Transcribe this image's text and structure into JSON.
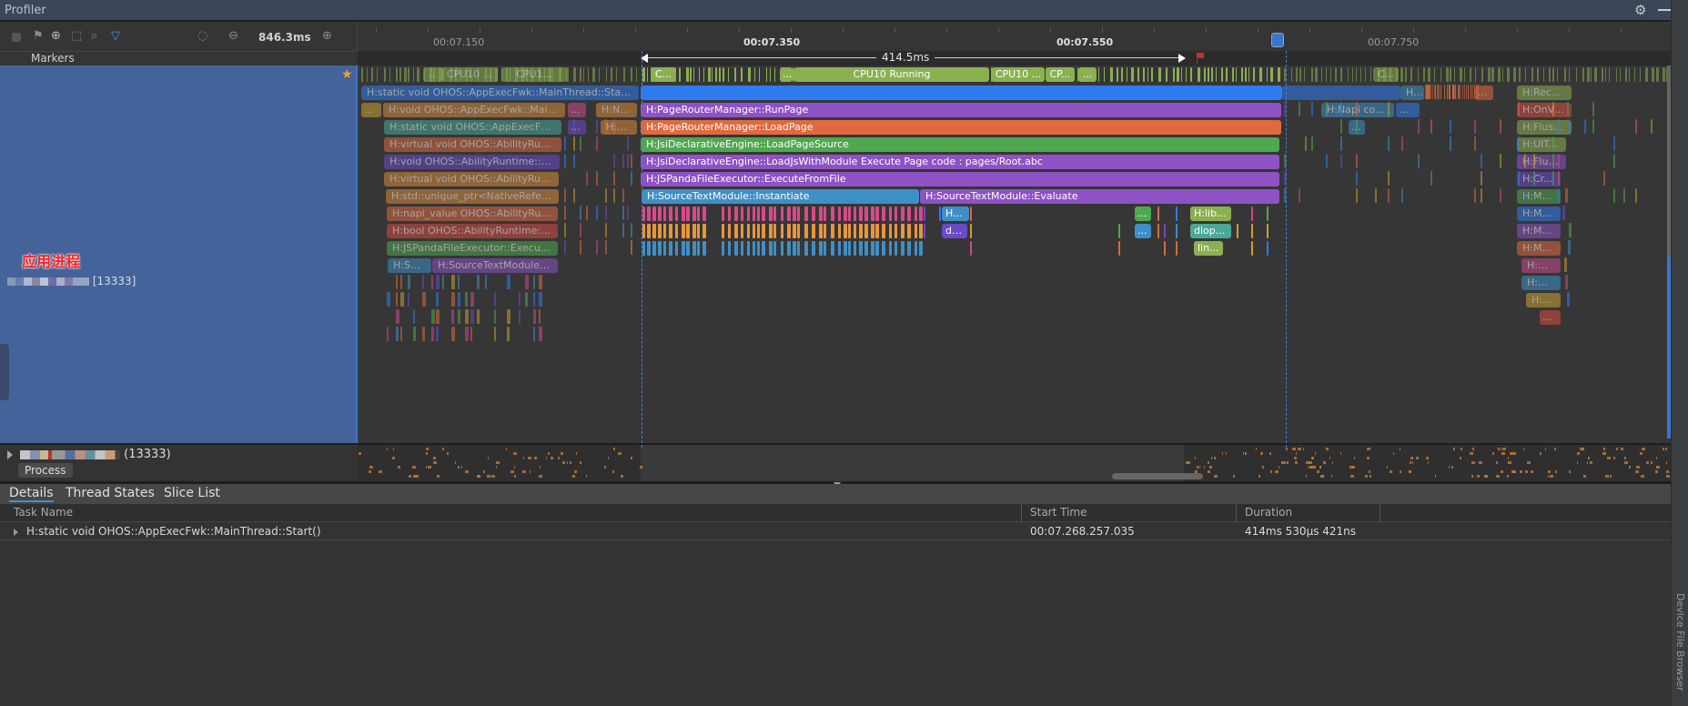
{
  "window": {
    "title": "Profiler"
  },
  "toolbar": {
    "icons": [
      "stop-icon",
      "flag-icon",
      "record-icon",
      "screenshot-icon",
      "search-icon",
      "filter-icon",
      "reset-zoom-icon",
      "zoom-out-icon",
      "zoom-in-icon"
    ],
    "zoom_level": "846.3ms"
  },
  "markers": {
    "label": "Markers"
  },
  "ruler": {
    "ticks": [
      {
        "label": "00:07.150",
        "bold": false
      },
      {
        "label": "00:07.350",
        "bold": true
      },
      {
        "label": "00:07.550",
        "bold": true
      },
      {
        "label": "00:07.750",
        "bold": false
      }
    ],
    "selection_duration": "414.5ms"
  },
  "process": {
    "annotation": "应用进程",
    "pid_label": "[13333]",
    "collapsed_pid_label": "(13333)",
    "badge": "Process"
  },
  "cpu_states": [
    {
      "label": "...",
      "selected": false
    },
    {
      "label": "CPU10 ...",
      "selected": false
    },
    {
      "label": "CPU1...",
      "selected": false
    },
    {
      "label": "C...",
      "selected": true
    },
    {
      "label": "...",
      "selected": true
    },
    {
      "label": "CPU10 Running",
      "selected": true
    },
    {
      "label": "CPU10 ...",
      "selected": true
    },
    {
      "label": "CP...",
      "selected": true
    },
    {
      "label": "...",
      "selected": true
    },
    {
      "label": "C...",
      "selected": false
    }
  ],
  "slices": {
    "pre": [
      "H:static void OHOS::AppExecFwk::MainThread::Start()",
      "H:void OHOS::AppExecFwk::Main...",
      "H:static void OHOS::AppExecFwk:...",
      "H:virtual void OHOS::AbilityRunti...",
      "H:void OHOS::AbilityRuntime::UI...",
      "H:virtual void OHOS::AbilityRunt...",
      "H:std::unique_ptr<NativeRefere...",
      "H:napi_value OHOS::AbilityRunt...",
      "H:bool OHOS::AbilityRuntime::J...",
      "H:JSPandaFileExecutor::Execute...",
      "H:Sou...",
      "H:SourceTextModule::..."
    ],
    "pre_small": [
      "...",
      "...",
      "H:Na...",
      "...",
      "H:C..."
    ],
    "selected": [
      "H:PageRouterManager::RunPage",
      "H:PageRouterManager::LoadPage",
      "H:JsiDeclarativeEngine::LoadPageSource",
      "H:JsiDeclarativeEngine::LoadJsWithModule Execute Page code : pages/Root.abc",
      "H:JSPandaFileExecutor::ExecuteFromFile",
      "H:SourceTextModule::Instantiate",
      "H:SourceTextModule::Evaluate"
    ],
    "selected_small": [
      "H...",
      "dl...",
      "...",
      "...",
      "H:lib...",
      "dlop...",
      "lin..."
    ],
    "post": [
      "H...",
      "H:Napi co...",
      "...",
      "...",
      "..."
    ],
    "post_stack": [
      "H:Recei...",
      "H:OnVs...",
      "H:Flush...",
      "H:UITa...",
      "H:Flus...",
      "H:Cr...",
      "H:Me...",
      "H:Me...",
      "H:Me...",
      "H:Me...",
      "H:M...",
      "H:M...",
      "H:...",
      "..."
    ]
  },
  "bottom_tabs": [
    {
      "label": "Details",
      "active": true
    },
    {
      "label": "Thread States",
      "active": false
    },
    {
      "label": "Slice List",
      "active": false
    }
  ],
  "details_table": {
    "columns": [
      "Task Name",
      "Start Time",
      "Duration"
    ],
    "rows": [
      {
        "task_name": "H:static void OHOS::AppExecFwk::MainThread::Start()",
        "start_time": "00:07.268.257.035",
        "duration": "414ms 530µs 421ns"
      }
    ]
  },
  "side_tool_window": {
    "label": "Device File Browser"
  },
  "colors": {
    "accent": "#3b74d0",
    "selected_thread_bg": "#44639a",
    "cpu_running": "#8bb050",
    "main_thread_slice": "#2f7bf0",
    "purple_slice": "#8e52c4",
    "orange_slice": "#e06a40",
    "green_slice": "#4fa84f",
    "blue_slice": "#3f8fc7",
    "annotation_red": "#ff2020"
  }
}
